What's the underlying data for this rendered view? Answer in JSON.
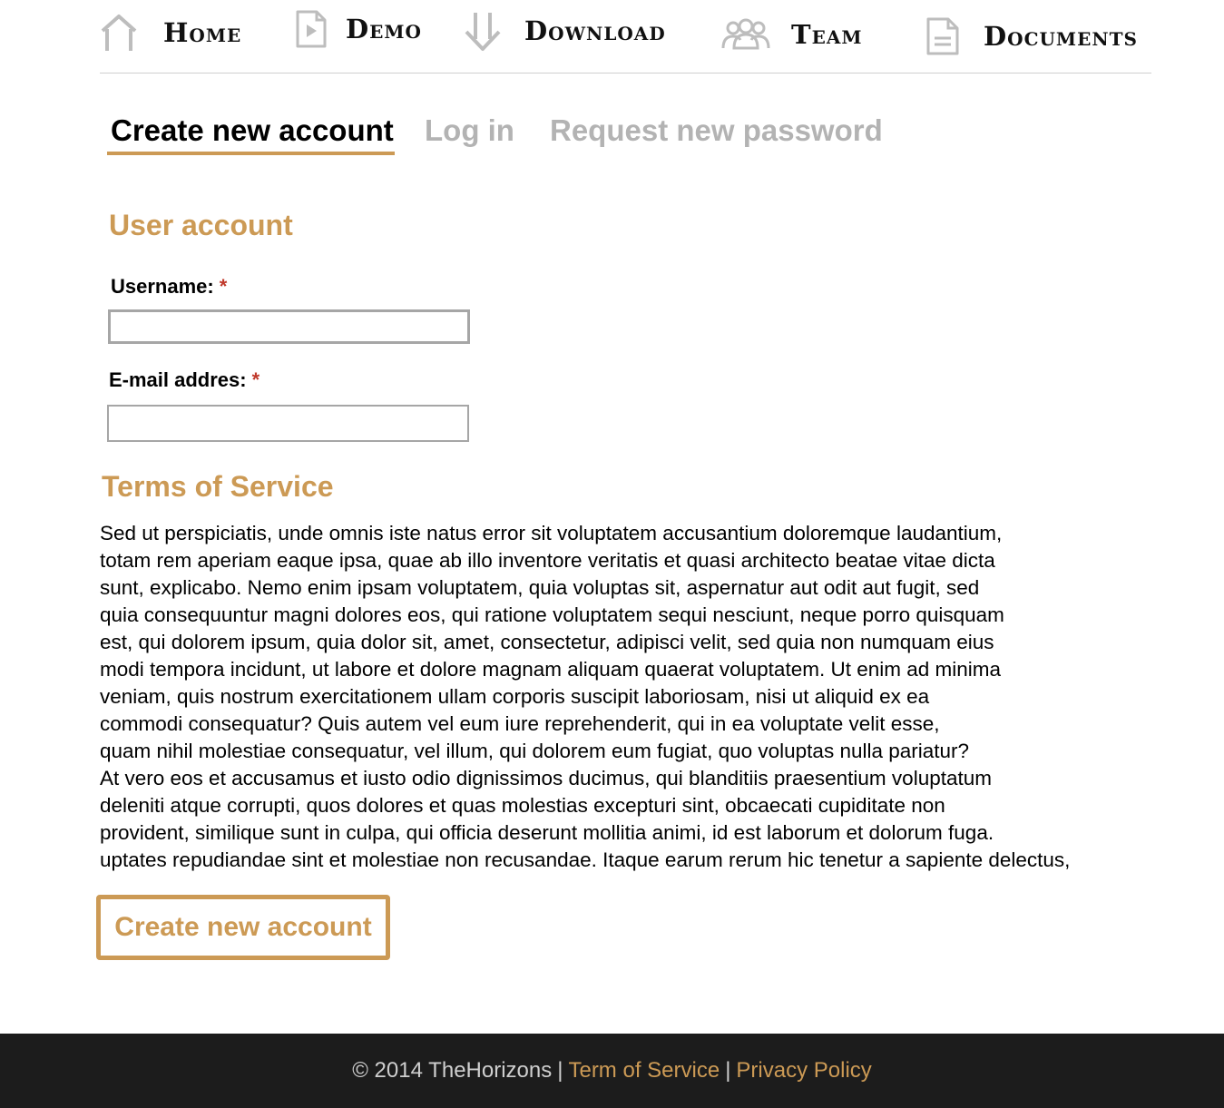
{
  "nav": {
    "items": [
      {
        "label": "Home",
        "icon": "home-icon"
      },
      {
        "label": "Demo",
        "icon": "demo-icon"
      },
      {
        "label": "Download",
        "icon": "download-icon"
      },
      {
        "label": "Team",
        "icon": "team-icon"
      },
      {
        "label": "Documents",
        "icon": "document-icon"
      }
    ]
  },
  "tabs": [
    {
      "label": "Create new account",
      "active": true
    },
    {
      "label": "Log in",
      "active": false
    },
    {
      "label": "Request new password",
      "active": false
    }
  ],
  "user_account": {
    "heading": "User account",
    "username": {
      "label": "Username:",
      "required_mark": "*",
      "value": "",
      "placeholder": ""
    },
    "email": {
      "label": "E-mail addres:",
      "required_mark": "*",
      "value": "",
      "placeholder": ""
    }
  },
  "terms": {
    "heading": "Terms of Service",
    "lines": [
      "Sed ut perspiciatis, unde omnis iste natus error sit voluptatem accusantium doloremque laudantium,",
      "totam rem aperiam eaque ipsa, quae ab illo inventore veritatis et quasi architecto beatae vitae dicta",
      "sunt, explicabo. Nemo enim ipsam voluptatem, quia voluptas sit, aspernatur aut odit aut fugit, sed",
      "quia consequuntur magni dolores eos, qui ratione voluptatem sequi nesciunt, neque porro quisquam",
      "est, qui dolorem ipsum, quia dolor sit, amet, consectetur, adipisci velit, sed quia non numquam eius",
      "modi tempora incidunt, ut labore et dolore magnam aliquam quaerat voluptatem. Ut enim ad minima",
      "veniam, quis nostrum exercitationem ullam corporis suscipit laboriosam, nisi ut aliquid ex ea",
      "commodi consequatur? Quis autem vel eum iure reprehenderit, qui in ea voluptate velit esse,",
      "quam nihil molestiae consequatur, vel illum, qui dolorem eum fugiat, quo voluptas nulla pariatur?",
      "At vero eos et accusamus et iusto odio dignissimos ducimus, qui blanditiis praesentium voluptatum",
      "deleniti atque corrupti, quos dolores et quas molestias excepturi sint, obcaecati cupiditate non",
      "provident, similique sunt in culpa, qui officia deserunt mollitia animi, id est laborum et dolorum fuga.",
      "uptates repudiandae sint et molestiae non recusandae. Itaque earum rerum hic tenetur a sapiente delectus,"
    ]
  },
  "submit_label": "Create new account",
  "footer": {
    "copyright": "© 2014 TheHorizons",
    "separator": "|",
    "terms_link": "Term of Service",
    "privacy_link": "Privacy Policy"
  },
  "colors": {
    "accent": "#cc9a55",
    "inactive_tab": "#b3b3b3",
    "required": "#c0392b",
    "footer_bg": "#1c1c1c",
    "icon_gray": "#bdbdbd"
  }
}
